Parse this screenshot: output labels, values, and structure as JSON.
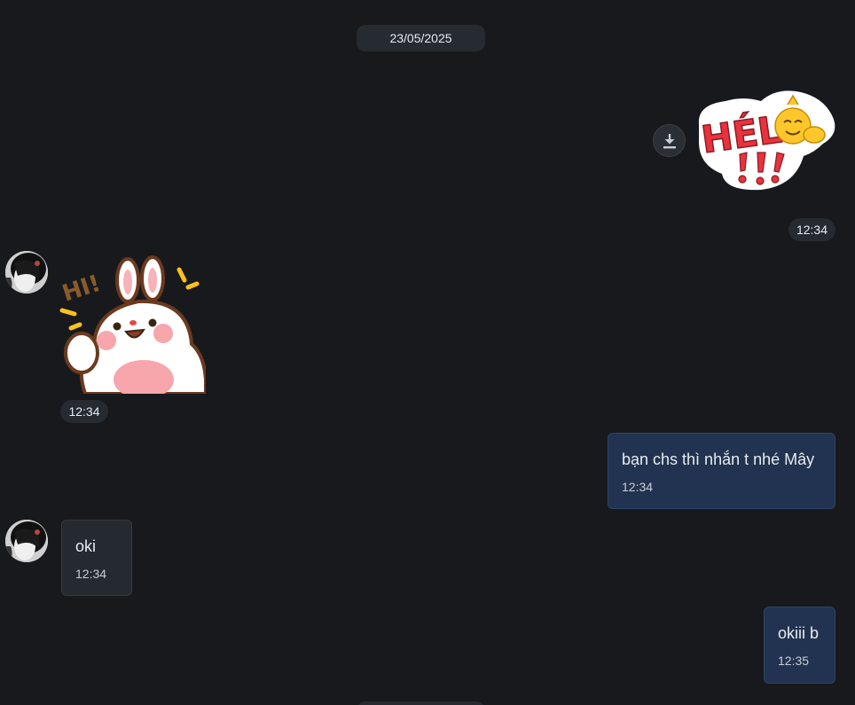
{
  "date_separator": "23/05/2025",
  "messages": [
    {
      "kind": "sticker",
      "direction": "outgoing",
      "sticker": "hello-sticker",
      "text": "HÉLÔ !!!",
      "time": "12:34"
    },
    {
      "kind": "sticker",
      "direction": "incoming",
      "sticker": "bunny-hi-sticker",
      "text": "HI!",
      "time": "12:34"
    },
    {
      "kind": "text",
      "direction": "outgoing",
      "text": "bạn chs thì nhắn t nhé Mây",
      "time": "12:34"
    },
    {
      "kind": "text",
      "direction": "incoming",
      "text": "oki",
      "time": "12:34"
    },
    {
      "kind": "text",
      "direction": "outgoing",
      "text": "okiii b",
      "time": "12:35"
    }
  ],
  "icons": {
    "download": "download-icon"
  },
  "colors": {
    "background": "#17191d",
    "outgoing_bubble": "#213350",
    "incoming_bubble": "#252930",
    "pill": "#262a31"
  }
}
